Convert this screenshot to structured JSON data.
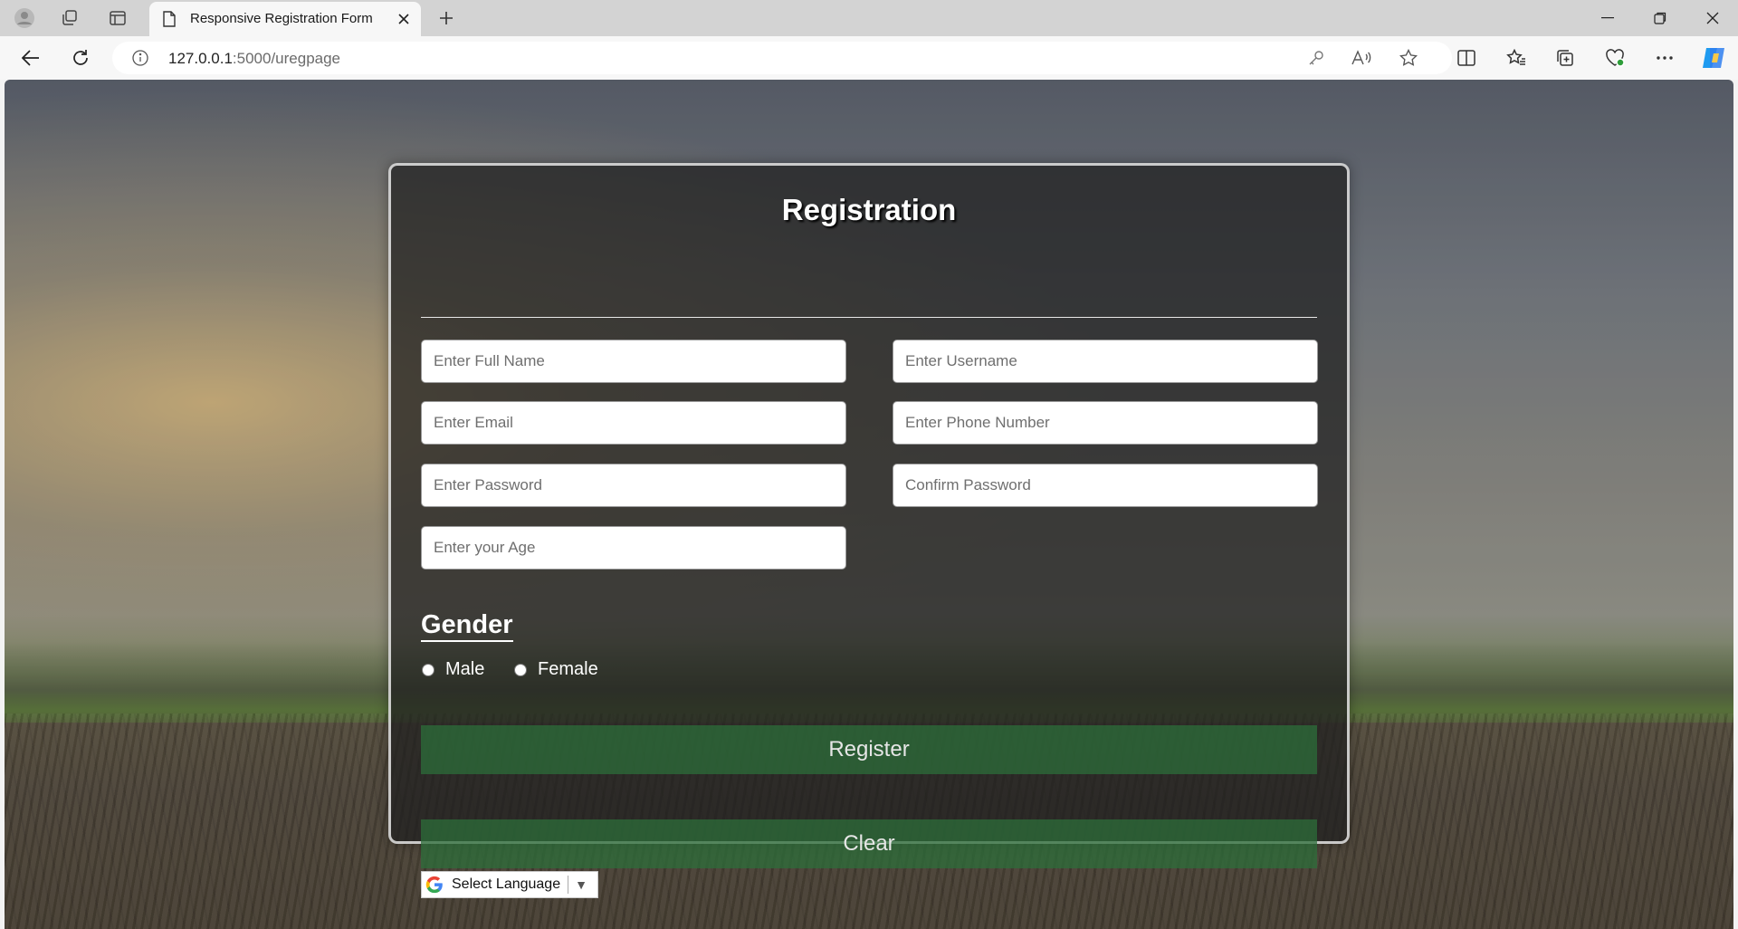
{
  "browser": {
    "tab_title": "Responsive Registration Form",
    "url_host": "127.0.0.1",
    "url_path": ":5000/uregpage"
  },
  "form": {
    "title": "Registration",
    "fields": {
      "full_name": "Enter Full Name",
      "username": "Enter Username",
      "email": "Enter Email",
      "phone": "Enter Phone Number",
      "password": "Enter Password",
      "confirm_password": "Confirm Password",
      "age": "Enter your Age"
    },
    "gender": {
      "title": "Gender",
      "options": [
        "Male",
        "Female"
      ],
      "selected": null
    },
    "register_label": "Register",
    "clear_label": "Clear",
    "language_label": "Select Language",
    "language_arrow": "▼"
  },
  "colors": {
    "button_green": "#2c6e3a",
    "card_bg": "#1e1e1e"
  }
}
